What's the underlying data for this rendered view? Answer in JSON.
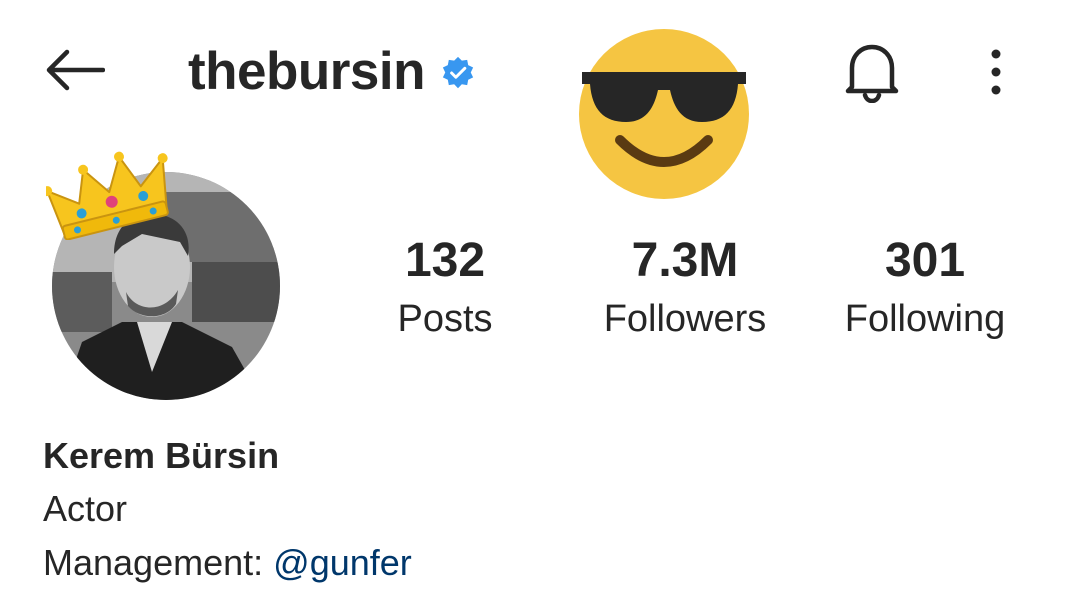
{
  "header": {
    "username": "thebursin",
    "verified": true,
    "icons": {
      "back": "arrow-left-icon",
      "verified": "verified-badge-icon",
      "emoji": "smiling-face-with-sunglasses",
      "notifications": "bell-icon",
      "more": "more-vertical-icon"
    }
  },
  "profile": {
    "avatar_decoration": "crown",
    "stats": [
      {
        "value": "132",
        "label": "Posts"
      },
      {
        "value": "7.3M",
        "label": "Followers"
      },
      {
        "value": "301",
        "label": "Following"
      }
    ]
  },
  "bio": {
    "name": "Kerem Bürsin",
    "category": "Actor",
    "management_prefix": "Management:",
    "management_handle": "@gunfer"
  },
  "colors": {
    "text": "#262626",
    "link": "#00376b",
    "verified": "#3897f0",
    "emoji_face": "#f5c542"
  }
}
